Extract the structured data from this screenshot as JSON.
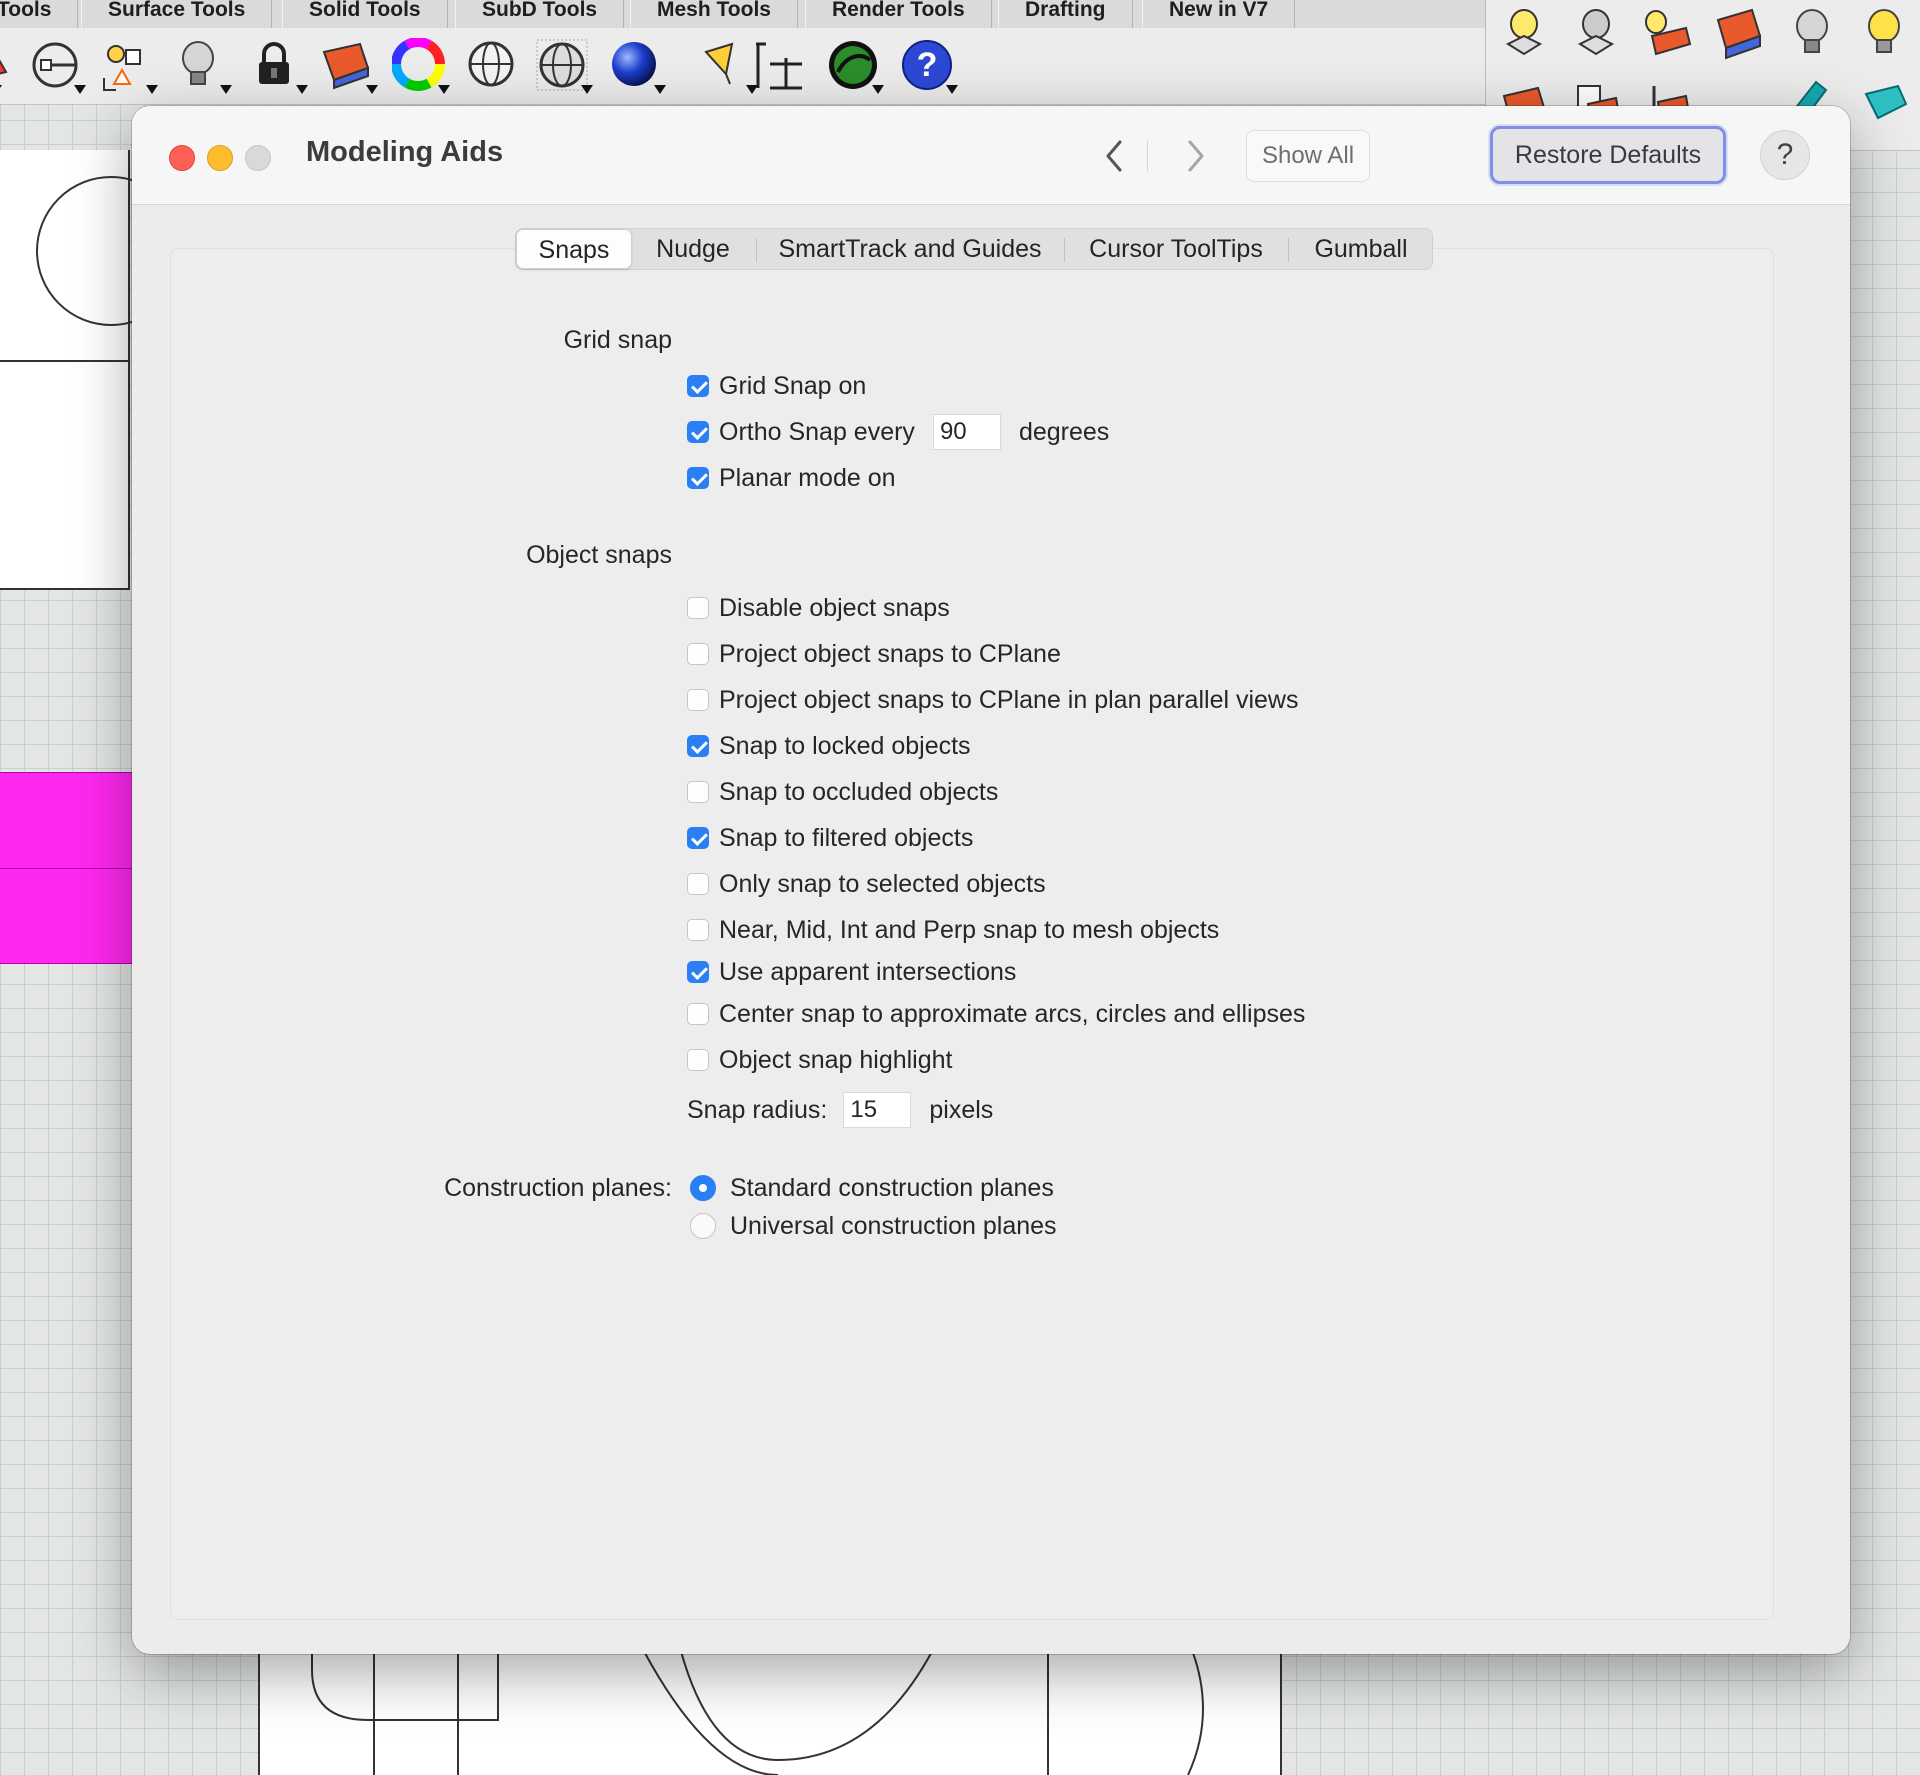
{
  "app": {
    "tabs": [
      "Tools",
      "Surface Tools",
      "Solid Tools",
      "SubD Tools",
      "Mesh Tools",
      "Render Tools",
      "Drafting",
      "New in V7"
    ],
    "toolbar_icons": [
      "snap-icon",
      "object-snap-icon",
      "light-bulb-icon",
      "lock-icon",
      "layer-icon",
      "color-wheel-icon",
      "sphere-wire-icon",
      "sphere-grid-icon",
      "blue-sphere-icon",
      "flag-icon",
      "dimension-icon",
      "render-globe-icon",
      "help-icon"
    ]
  },
  "dialog": {
    "title": "Modeling Aids",
    "show_all": "Show All",
    "restore_defaults": "Restore Defaults",
    "help": "?",
    "tabs": [
      {
        "label": "Snaps",
        "active": true
      },
      {
        "label": "Nudge",
        "active": false
      },
      {
        "label": "SmartTrack and Guides",
        "active": false
      },
      {
        "label": "Cursor ToolTips",
        "active": false
      },
      {
        "label": "Gumball",
        "active": false
      }
    ]
  },
  "grid_snap": {
    "heading": "Grid snap",
    "grid_snap_on": {
      "label": "Grid Snap on",
      "checked": true
    },
    "ortho": {
      "label": "Ortho Snap every",
      "value": "90",
      "unit": "degrees",
      "checked": true
    },
    "planar": {
      "label": "Planar mode on",
      "checked": true
    }
  },
  "object_snaps": {
    "heading": "Object snaps",
    "options": [
      {
        "label": "Disable object snaps",
        "checked": false
      },
      {
        "label": "Project object snaps to CPlane",
        "checked": false
      },
      {
        "label": "Project object snaps to CPlane in plan parallel views",
        "checked": false
      },
      {
        "label": "Snap to locked objects",
        "checked": true
      },
      {
        "label": "Snap to occluded objects",
        "checked": false
      },
      {
        "label": "Snap to filtered objects",
        "checked": true
      },
      {
        "label": "Only snap to selected objects",
        "checked": false
      },
      {
        "label": "Near, Mid, Int and Perp snap to mesh objects",
        "checked": false
      },
      {
        "label": "Use apparent intersections",
        "checked": true
      },
      {
        "label": "Center snap to approximate arcs, circles and ellipses",
        "checked": false
      },
      {
        "label": "Object snap highlight",
        "checked": false
      }
    ],
    "snap_radius": {
      "label": "Snap radius:",
      "value": "15",
      "unit": "pixels"
    }
  },
  "construction_planes": {
    "label": "Construction planes:",
    "standard": {
      "label": "Standard construction planes",
      "selected": true
    },
    "universal": {
      "label": "Universal construction planes",
      "selected": false
    }
  },
  "colors": {
    "accent": "#2a7ff5",
    "focus_ring": "#7f8ee6",
    "magenta": "#ff28f0"
  }
}
